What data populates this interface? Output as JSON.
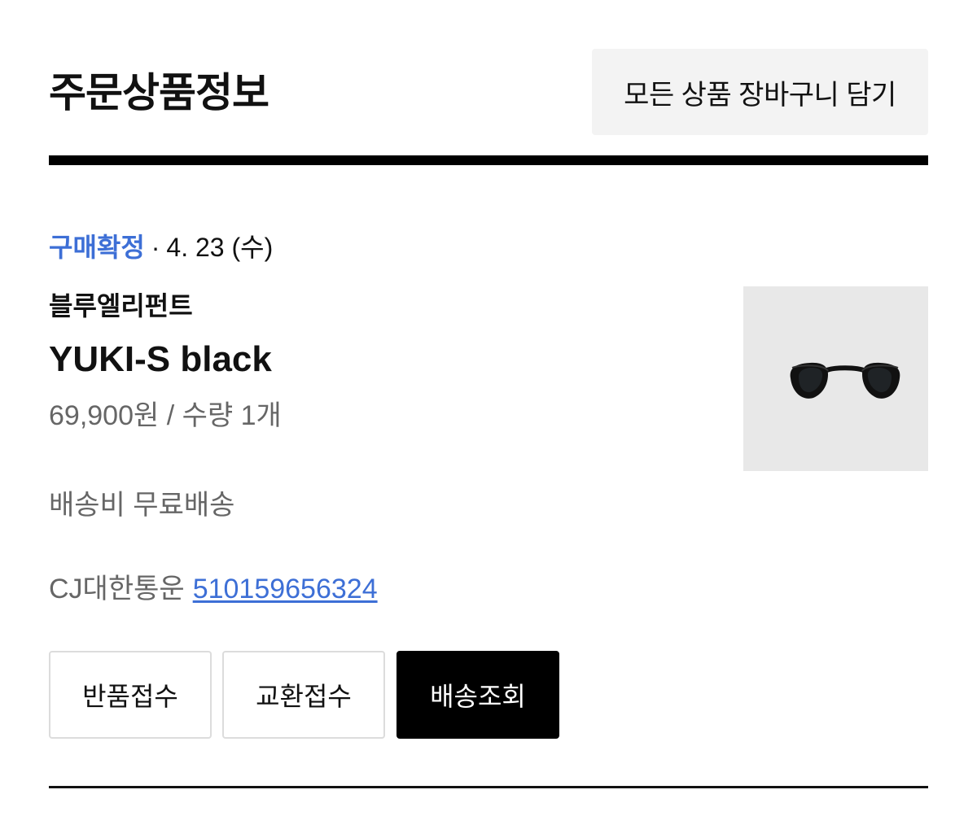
{
  "header": {
    "title": "주문상품정보",
    "cart_all_label": "모든 상품 장바구니 담기"
  },
  "order": {
    "status": "구매확정",
    "separator": "·",
    "date": "4. 23 (수)",
    "brand": "블루엘리펀트",
    "product_name": "YUKI-S black",
    "price_qty": "69,900원 / 수량 1개",
    "shipping_fee": "배송비 무료배송",
    "courier": "CJ대한통운",
    "tracking_number": "510159656324",
    "image": {
      "icon": "sunglasses-icon",
      "background_color": "#e8e8e8",
      "frame_color": "#111111"
    }
  },
  "actions": {
    "return_label": "반품접수",
    "exchange_label": "교환접수",
    "track_label": "배송조회"
  },
  "colors": {
    "accent": "#3d6fd6",
    "primary_button": "#000000",
    "secondary_text": "#666666"
  }
}
